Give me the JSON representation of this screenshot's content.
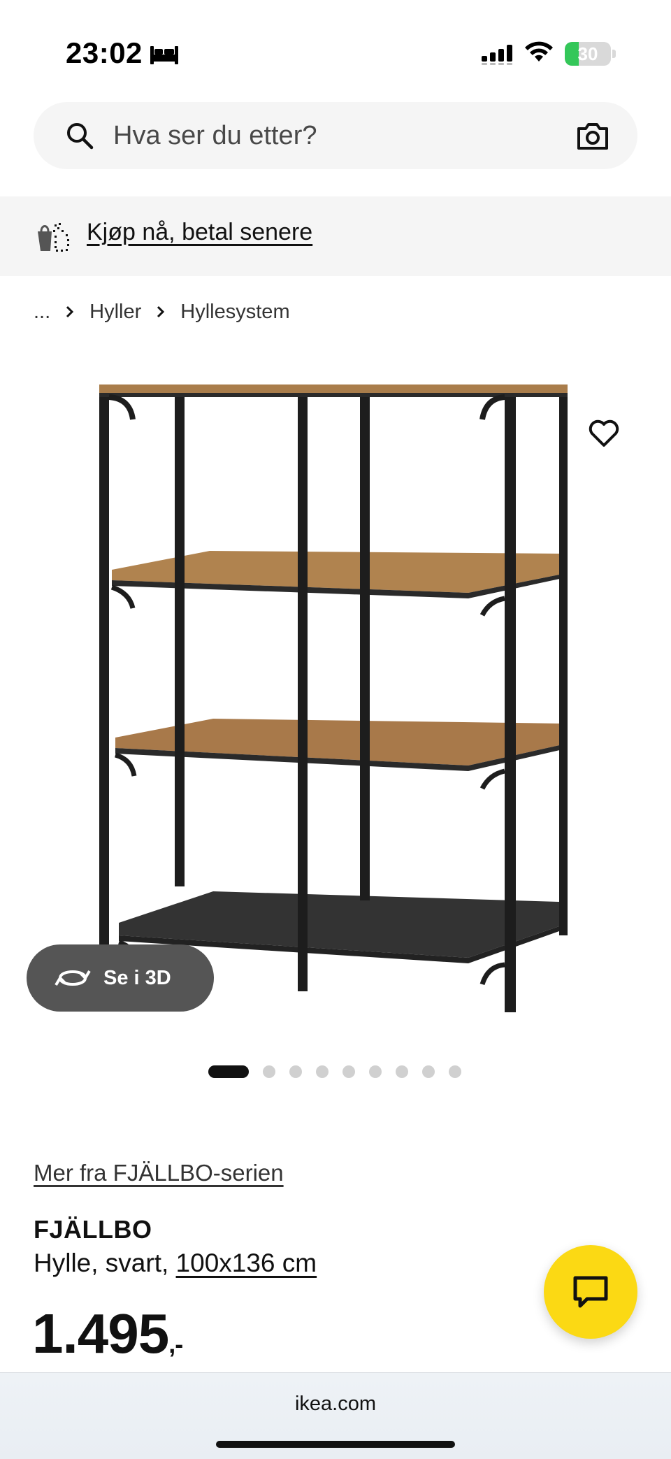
{
  "status_bar": {
    "time": "23:02",
    "battery_percent": 30,
    "battery_label": "30"
  },
  "search": {
    "placeholder": "Hva ser du etter?"
  },
  "promo": {
    "link_text": "Kjøp nå, betal senere"
  },
  "breadcrumb": {
    "ellipsis": "...",
    "items": [
      {
        "label": "Hyller"
      },
      {
        "label": "Hyllesystem"
      }
    ]
  },
  "gallery": {
    "view_3d_label": "Se i 3D",
    "total_images": 9,
    "active_index": 0
  },
  "product": {
    "series_link": "Mer fra FJÄLLBO-serien",
    "name": "FJÄLLBO",
    "description": "Hylle, svart, ",
    "size": "100x136 cm",
    "price_main": "1.495",
    "price_suffix": ",-"
  },
  "browser": {
    "url": "ikea.com"
  },
  "colors": {
    "accent_yellow": "#fbd914",
    "battery_green": "#34c759",
    "button_gray": "#555555"
  }
}
